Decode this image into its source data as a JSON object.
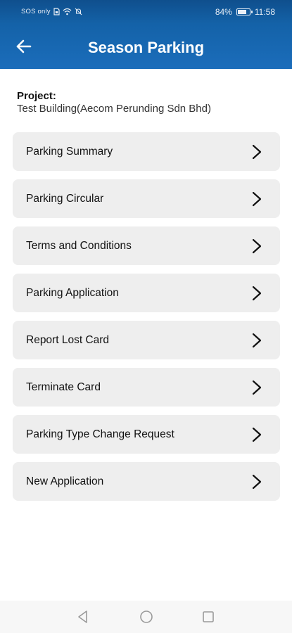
{
  "status_bar": {
    "sos": "SOS only",
    "battery_pct": "84%",
    "battery_level": 0.84,
    "time": "11:58"
  },
  "app_bar": {
    "title": "Season Parking",
    "back_icon": "arrow-left-icon"
  },
  "project": {
    "label": "Project:",
    "name": "Test Building(Aecom Perunding Sdn Bhd)"
  },
  "menu": {
    "items": [
      {
        "label": "Parking Summary"
      },
      {
        "label": "Parking Circular"
      },
      {
        "label": "Terms and Conditions"
      },
      {
        "label": "Parking Application"
      },
      {
        "label": "Report Lost Card"
      },
      {
        "label": "Terminate Card"
      },
      {
        "label": "Parking Type Change Request"
      },
      {
        "label": "New Application"
      }
    ],
    "chevron_icon": "chevron-right-icon"
  },
  "nav_bar": {
    "icons": [
      "back-triangle-icon",
      "home-circle-icon",
      "recents-square-icon"
    ]
  },
  "colors": {
    "header": "#1462a8",
    "menu_bg": "#eeeeee"
  }
}
